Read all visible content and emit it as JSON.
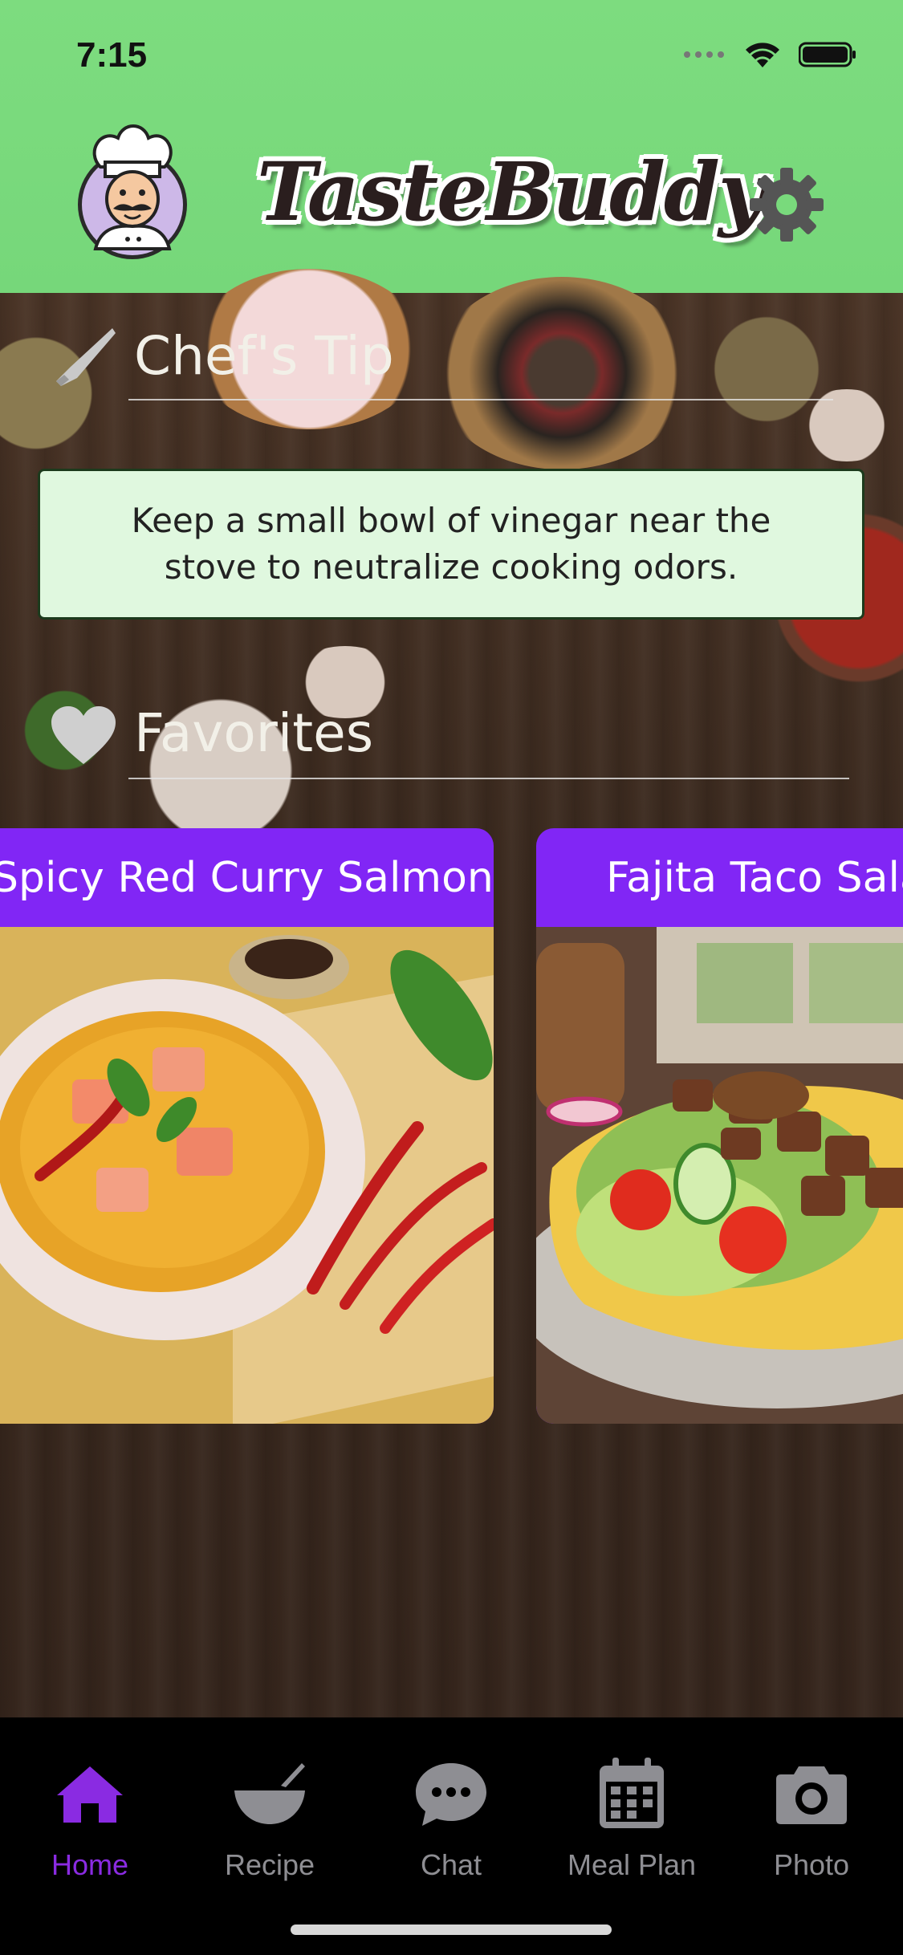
{
  "status_bar": {
    "time": "7:15"
  },
  "header": {
    "app_title": "TasteBuddy"
  },
  "chefs_tip": {
    "heading": "Chef's Tip",
    "text": "Keep a small bowl of vinegar near the stove to neutralize cooking odors."
  },
  "favorites": {
    "heading": "Favorites",
    "items": [
      {
        "title": "Spicy Red Curry Salmon"
      },
      {
        "title": "Fajita Taco Salad"
      }
    ]
  },
  "tab_bar": {
    "items": [
      {
        "label": "Home",
        "icon": "home-icon",
        "active": true
      },
      {
        "label": "Recipe",
        "icon": "bowl-icon",
        "active": false
      },
      {
        "label": "Chat",
        "icon": "chat-bubble-icon",
        "active": false
      },
      {
        "label": "Meal Plan",
        "icon": "calendar-icon",
        "active": false
      },
      {
        "label": "Photo",
        "icon": "camera-icon",
        "active": false
      }
    ]
  },
  "colors": {
    "header_green": "#7ddc7f",
    "accent_purple": "#8126f5",
    "tip_background": "#e0f8df",
    "tab_active": "#8a2be2",
    "tab_inactive": "#8e8e93"
  }
}
